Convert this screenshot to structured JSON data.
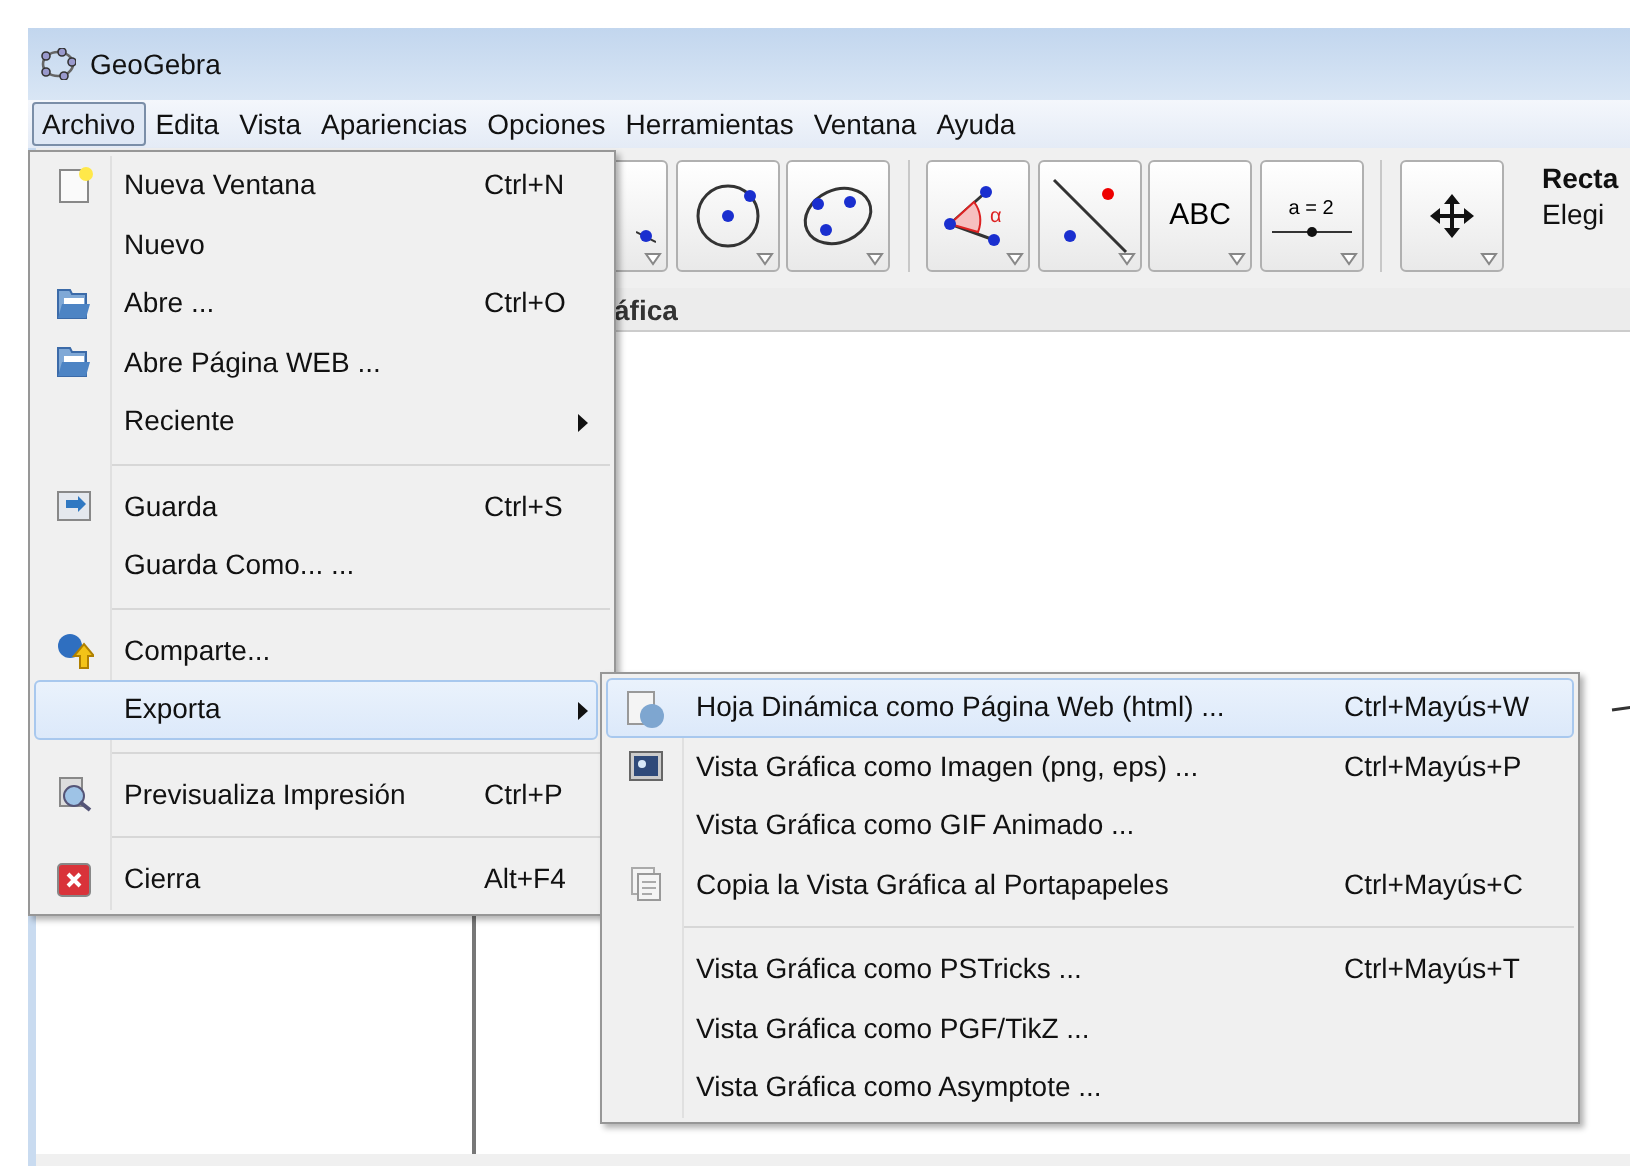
{
  "window": {
    "title": "GeoGebra"
  },
  "menubar": [
    {
      "label": "Archivo",
      "selected": true
    },
    {
      "label": "Edita",
      "selected": false
    },
    {
      "label": "Vista",
      "selected": false
    },
    {
      "label": "Apariencias",
      "selected": false
    },
    {
      "label": "Opciones",
      "selected": false
    },
    {
      "label": "Herramientas",
      "selected": false
    },
    {
      "label": "Ventana",
      "selected": false
    },
    {
      "label": "Ayuda",
      "selected": false
    }
  ],
  "toolbar": {
    "tools": [
      {
        "kind": "point"
      },
      {
        "kind": "circle"
      },
      {
        "kind": "conic"
      },
      {
        "kind": "angle",
        "label": "α"
      },
      {
        "kind": "reflect"
      },
      {
        "kind": "text",
        "label": "ABC"
      },
      {
        "kind": "slider",
        "label": "a = 2"
      },
      {
        "kind": "move"
      }
    ],
    "tool_name": "Recta",
    "tool_help": "Elegi"
  },
  "graphics_view": {
    "title": "áfica"
  },
  "file_menu": {
    "sections": [
      [
        {
          "label": "Nueva Ventana",
          "shortcut": "Ctrl+N",
          "submenu": false,
          "selected": false
        },
        {
          "label": "Nuevo",
          "submenu": false,
          "selected": false
        },
        {
          "label": "Abre ...",
          "shortcut": "Ctrl+O",
          "submenu": false,
          "selected": false
        },
        {
          "label": "Abre Página WEB ...",
          "submenu": false,
          "selected": false
        },
        {
          "label": "Reciente",
          "submenu": true,
          "selected": false
        }
      ],
      [
        {
          "label": "Guarda",
          "shortcut": "Ctrl+S",
          "submenu": false,
          "selected": false
        },
        {
          "label": "Guarda Como... ...",
          "submenu": false,
          "selected": false
        }
      ],
      [
        {
          "label": "Comparte...",
          "submenu": false,
          "selected": false
        },
        {
          "label": "Exporta",
          "submenu": true,
          "selected": true
        }
      ],
      [
        {
          "label": "Previsualiza Impresión",
          "shortcut": "Ctrl+P",
          "submenu": false,
          "selected": false
        }
      ],
      [
        {
          "label": "Cierra",
          "shortcut": "Alt+F4",
          "submenu": false,
          "selected": false
        }
      ]
    ]
  },
  "export_menu": {
    "sections": [
      [
        {
          "label": "Hoja Dinámica como Página Web (html) ...",
          "shortcut": "Ctrl+Mayús+W",
          "selected": true
        },
        {
          "label": "Vista Gráfica como Imagen (png, eps) ...",
          "shortcut": "Ctrl+Mayús+P",
          "selected": false
        },
        {
          "label": "Vista Gráfica como GIF Animado ...",
          "selected": false
        },
        {
          "label": "Copia la Vista Gráfica al Portapapeles",
          "shortcut": "Ctrl+Mayús+C",
          "selected": false
        }
      ],
      [
        {
          "label": "Vista Gráfica como PSTricks ...",
          "shortcut": "Ctrl+Mayús+T",
          "selected": false
        },
        {
          "label": "Vista Gráfica como PGF/TikZ ...",
          "selected": false
        },
        {
          "label": "Vista Gráfica como Asymptote ...",
          "selected": false
        }
      ]
    ]
  }
}
